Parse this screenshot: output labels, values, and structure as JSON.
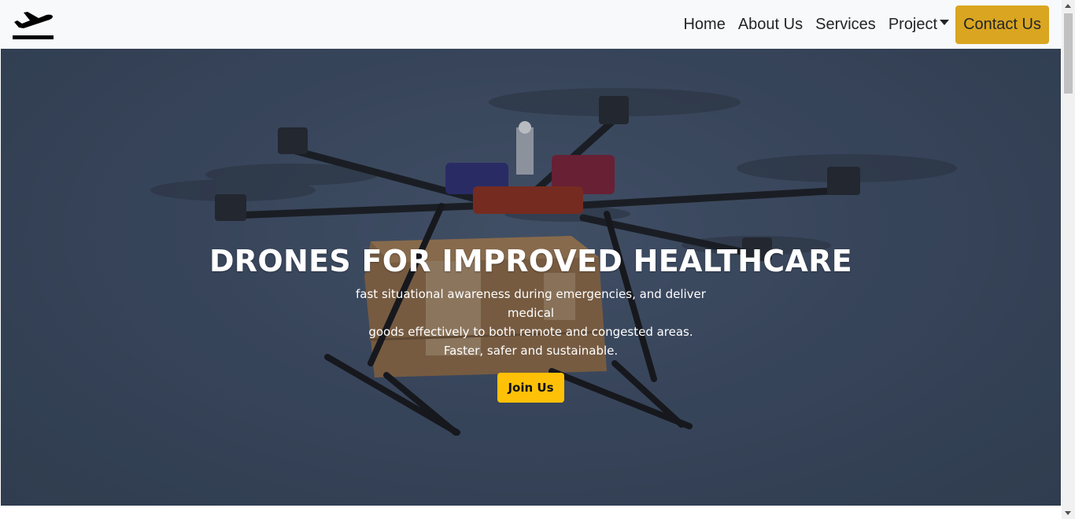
{
  "navbar": {
    "logo_icon": "airplane-departure-icon",
    "links": [
      {
        "label": "Home"
      },
      {
        "label": "About Us"
      },
      {
        "label": "Services"
      },
      {
        "label": "Project"
      }
    ],
    "contact_label": "Contact Us",
    "contact_color": "#daa520"
  },
  "hero": {
    "title": "DRONES FOR IMPROVED HEALTHCARE",
    "line1": "fast situational awareness during emergencies, and deliver medical",
    "line2": "goods effectively to both remote and congested areas.",
    "line3": "Faster, safer and sustainable.",
    "button_label": "Join Us",
    "button_color": "#ffc107",
    "background_image": "drone-carrying-box"
  }
}
